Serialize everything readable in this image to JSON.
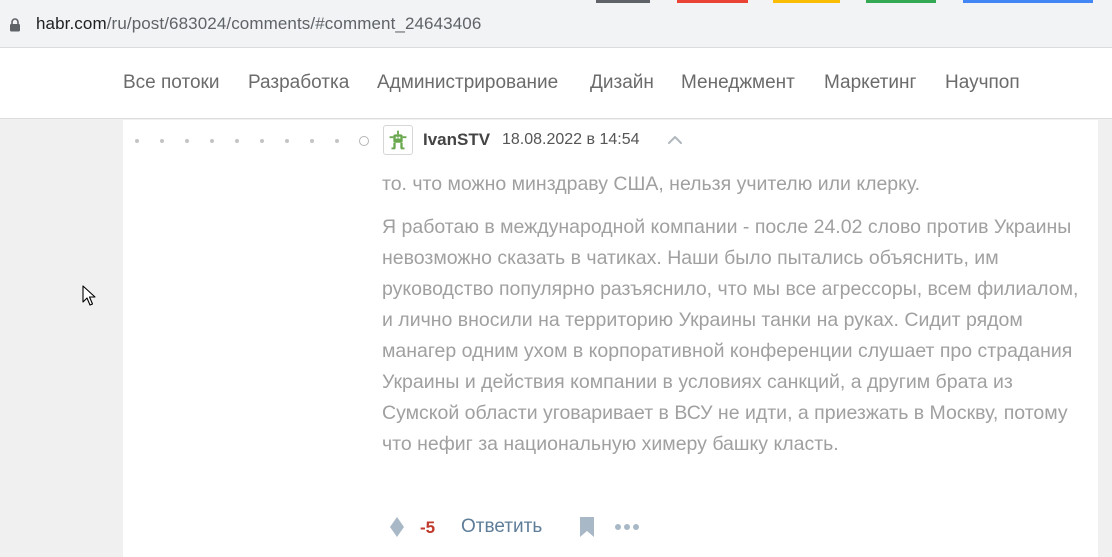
{
  "browser": {
    "url_host": "habr.com",
    "url_path": "/ru/post/683024/comments/#comment_24643406",
    "lock_icon": "lock-icon"
  },
  "nav": {
    "items": [
      {
        "label": "Все потоки"
      },
      {
        "label": "Разработка"
      },
      {
        "label": "Администрирование"
      },
      {
        "label": "Дизайн"
      },
      {
        "label": "Менеджмент"
      },
      {
        "label": "Маркетинг"
      },
      {
        "label": "Научпоп"
      }
    ]
  },
  "comment": {
    "author": "IvanSTV",
    "timestamp": "18.08.2022 в 14:54",
    "paragraphs": [
      "то. что можно минздраву США, нельзя учителю или клерку.",
      "Я работаю в международной компании - после 24.02 слово против Украины невозможно сказать в чатиках. Наши было пытались объяснить, им руководство популярно разъяснило, что мы все агрессоры, всем филиалом, и лично вносили на территорию Украины танки на руках. Сидит рядом манагер одним ухом в корпоративной конференции слушает про страдания Украины и действия компании в условиях санкций, а другим брата из Сумской области уговаривает в ВСУ не идти, а приезжать в Москву, потому что нефиг за национальную химеру башку класть."
    ],
    "score": "-5",
    "reply_label": "Ответить"
  },
  "colors": {
    "score_negative": "#c0392b",
    "reply_link": "#5e7d99",
    "avatar_green": "#6aa84f",
    "body_text": "#a0a0a0"
  }
}
